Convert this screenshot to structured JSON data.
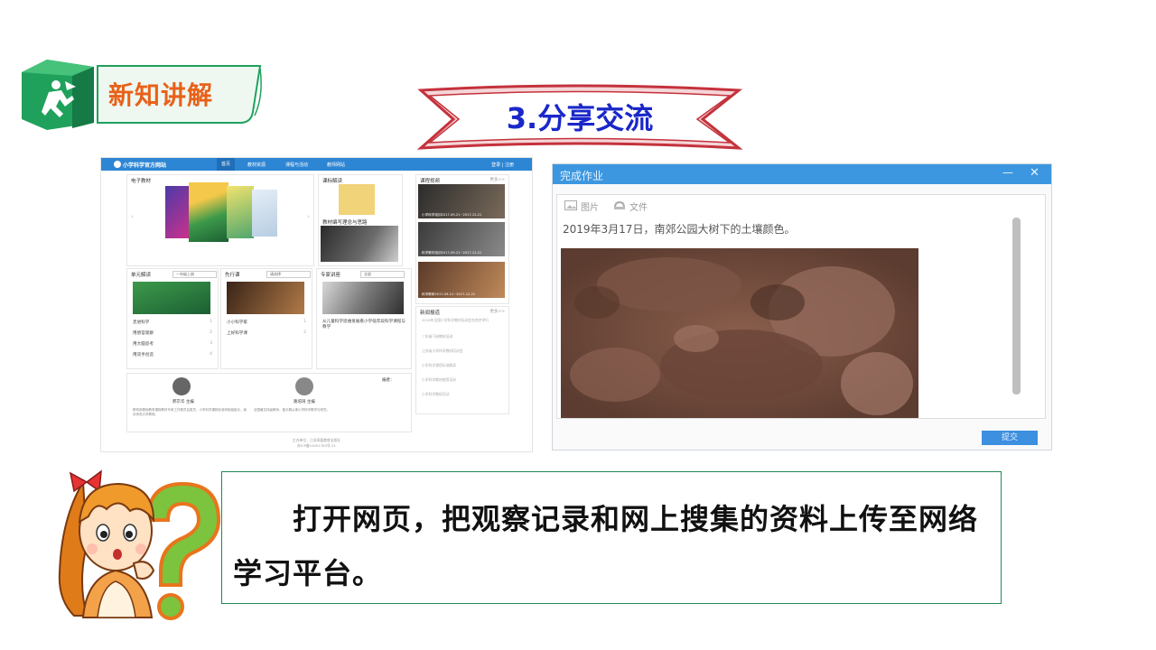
{
  "header": {
    "title": "新知讲解"
  },
  "section": {
    "title": "3.分享交流"
  },
  "website": {
    "site_name": "小学科学官方网站",
    "nav": [
      "首页",
      "教材资源",
      "课程与活动",
      "教师网站"
    ],
    "login": "登录 | 注册",
    "panels": {
      "ebook": "电子教材",
      "course_intro": "课标解读",
      "material_intro": "教材编写理念与思路",
      "course_video": "课程视频",
      "unit": "单元解读",
      "pioneer": "先行课",
      "expert": "专家讲座",
      "news": "新闻报道",
      "more": "更多>>"
    },
    "dropdowns": [
      "一年级上册",
      "请选择",
      "全部"
    ],
    "unit_list": [
      {
        "label": "走进科学",
        "num": "1"
      },
      {
        "label": "用感官观察",
        "num": "2"
      },
      {
        "label": "用大脑思考",
        "num": "3"
      },
      {
        "label": "用双手创造",
        "num": "4"
      }
    ],
    "pioneer_list": [
      {
        "label": "小小科学家",
        "num": "1"
      },
      {
        "label": "上好科学课",
        "num": "2"
      }
    ],
    "expert_text": "从儿童科学思维发展看小学低年段科学课程与教学",
    "video_captions": [
      "小学科学培训2017-09-21~2017-12-21",
      "科学教材培训2017-09-21~2017-12-21",
      "科学教研2017-09-21~2017-12-21"
    ],
    "news_items": [
      "2018年全国小学科学教材培训会在南京举行",
      "二年级下册教材培训",
      "江苏省小学科学教材培训会",
      "小学科学课程标准解读",
      "小学科学教材使用培训",
      "小学科学教研活动"
    ],
    "people": [
      {
        "name": "郝京华  主编",
        "text": "教育部基础教育课程教材专家工作委员会委员，小学科学课程标准研制组组长，南京师范大学教授。"
      },
      {
        "name": "路培琦  主编",
        "text": "全国著名特级教师，曾长期从事小学科学教学与研究。"
      }
    ],
    "editors_label": "编者：",
    "footer": [
      "主办单位：江苏凤凰教育出版社",
      "苏ICP备10051783号-21"
    ]
  },
  "dialog": {
    "title": "完成作业",
    "tools": [
      "图片",
      "文件"
    ],
    "text": "2019年3月17日，南郊公园大树下的土壤颜色。",
    "submit": "提交",
    "minimize": "—",
    "close": "✕"
  },
  "caption": {
    "text": "打开网页，把观察记录和网上搜集的资料上传至网络学习平台。"
  },
  "colors": {
    "badge_green": "#1fa15c",
    "badge_text": "#e8611a",
    "banner_border": "#c4323c",
    "banner_text": "#1a27c9",
    "caption_border": "#1f8a52",
    "dialog_bar": "#3d97e0"
  }
}
